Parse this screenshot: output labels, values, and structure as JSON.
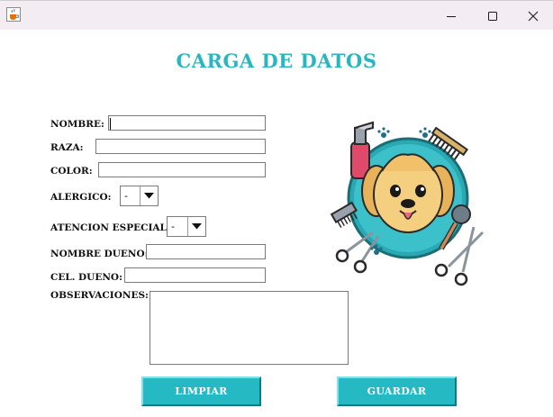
{
  "window": {
    "minimize_glyph": "—",
    "maximize_glyph": "☐",
    "close_glyph": "✕",
    "app_icon": "java-cup-icon"
  },
  "form": {
    "title": "CARGA DE DATOS",
    "fields": {
      "nombre": {
        "label": "NOMBRE:",
        "value": ""
      },
      "raza": {
        "label": "RAZA:",
        "value": ""
      },
      "color": {
        "label": "COLOR:",
        "value": ""
      },
      "alergico": {
        "label": "ALERGICO:",
        "selected": "-"
      },
      "atencion_especial": {
        "label": "ATENCION ESPECIAL:",
        "selected": "-"
      },
      "nombre_dueno": {
        "label": "NOMBRE DUENO:",
        "value": ""
      },
      "cel_dueno": {
        "label": "CEL. DUENO:",
        "value": ""
      },
      "observaciones": {
        "label": "OBSERVACIONES:",
        "value": ""
      }
    },
    "buttons": {
      "limpiar": "LIMPIAR",
      "guardar": "GUARDAR"
    }
  },
  "illustration": {
    "subject": "dog-grooming-logo"
  },
  "colors": {
    "accent": "#28b7c0",
    "button_bg": "#24b9c3",
    "titlebar_bg": "#f3edf3"
  }
}
